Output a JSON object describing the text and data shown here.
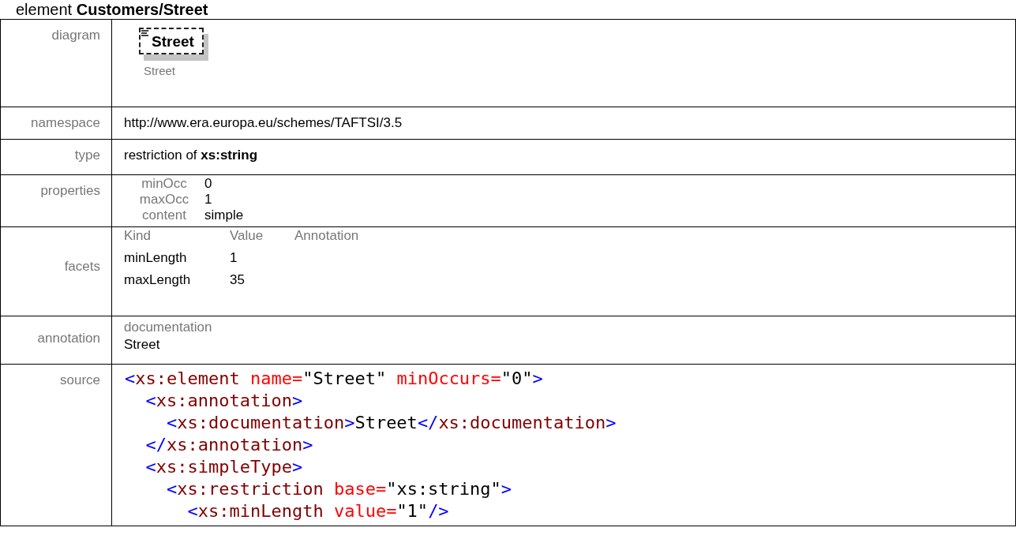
{
  "heading": "element **Customers/Street**",
  "diagram": {
    "label": "diagram",
    "box_title": "Street",
    "caption": "Street"
  },
  "namespace": {
    "label": "namespace",
    "value": "http://www.era.europa.eu/schemes/TAFTSI/3.5"
  },
  "type": {
    "label": "type",
    "value": "restriction of **xs:string**"
  },
  "properties": {
    "label": "properties",
    "items": [
      {
        "name": "minOcc",
        "value": "0"
      },
      {
        "name": "maxOcc",
        "value": "1"
      },
      {
        "name": "content",
        "value": "simple"
      }
    ]
  },
  "facets": {
    "label": "facets",
    "columns": [
      "Kind",
      "Value",
      "Annotation"
    ],
    "rows": [
      {
        "kind": "minLength",
        "value": "1"
      },
      {
        "kind": "maxLength",
        "value": "35"
      }
    ]
  },
  "annotation": {
    "label": "annotation",
    "heading": "documentation",
    "text": "Street"
  },
  "source": {
    "label": "source",
    "lines": [
      {
        "tokens": [
          {
            "kind": "punct",
            "text": "<"
          },
          {
            "kind": "tag",
            "text": "xs:element"
          },
          {
            "kind": "attr",
            "text": " name="
          },
          {
            "kind": "value",
            "text": "\"Street\""
          },
          {
            "kind": "attr",
            "text": " minOccurs="
          },
          {
            "kind": "value",
            "text": "\"0\""
          },
          {
            "kind": "punct",
            "text": ">"
          }
        ],
        "children": [
          {
            "tokens": [
              {
                "kind": "punct",
                "text": "<"
              },
              {
                "kind": "tag",
                "text": "xs:annotation"
              },
              {
                "kind": "punct",
                "text": ">"
              }
            ],
            "children": [
              {
                "tokens": [
                  {
                    "kind": "punct",
                    "text": "<"
                  },
                  {
                    "kind": "tag",
                    "text": "xs:documentation"
                  },
                  {
                    "kind": "punct",
                    "text": ">"
                  },
                  {
                    "kind": "value",
                    "text": "Street"
                  },
                  {
                    "kind": "punct",
                    "text": "</"
                  },
                  {
                    "kind": "tag",
                    "text": "xs:documentation"
                  },
                  {
                    "kind": "punct",
                    "text": ">"
                  }
                ]
              }
            ]
          },
          {
            "tokens": [
              {
                "kind": "punct",
                "text": "</"
              },
              {
                "kind": "tag",
                "text": "xs:annotation"
              },
              {
                "kind": "punct",
                "text": ">"
              }
            ]
          },
          {
            "tokens": [
              {
                "kind": "punct",
                "text": "<"
              },
              {
                "kind": "tag",
                "text": "xs:simpleType"
              },
              {
                "kind": "punct",
                "text": ">"
              }
            ],
            "children": [
              {
                "tokens": [
                  {
                    "kind": "punct",
                    "text": "<"
                  },
                  {
                    "kind": "tag",
                    "text": "xs:restriction"
                  },
                  {
                    "kind": "attr",
                    "text": " base="
                  },
                  {
                    "kind": "value",
                    "text": "\"xs:string\""
                  },
                  {
                    "kind": "punct",
                    "text": ">"
                  }
                ],
                "children": [
                  {
                    "tokens": [
                      {
                        "kind": "punct",
                        "text": "<"
                      },
                      {
                        "kind": "tag",
                        "text": "xs:minLength"
                      },
                      {
                        "kind": "attr",
                        "text": " value="
                      },
                      {
                        "kind": "value",
                        "text": "\"1\""
                      },
                      {
                        "kind": "punct",
                        "text": "/>"
                      }
                    ]
                  }
                ]
              }
            ]
          }
        ]
      }
    ]
  }
}
